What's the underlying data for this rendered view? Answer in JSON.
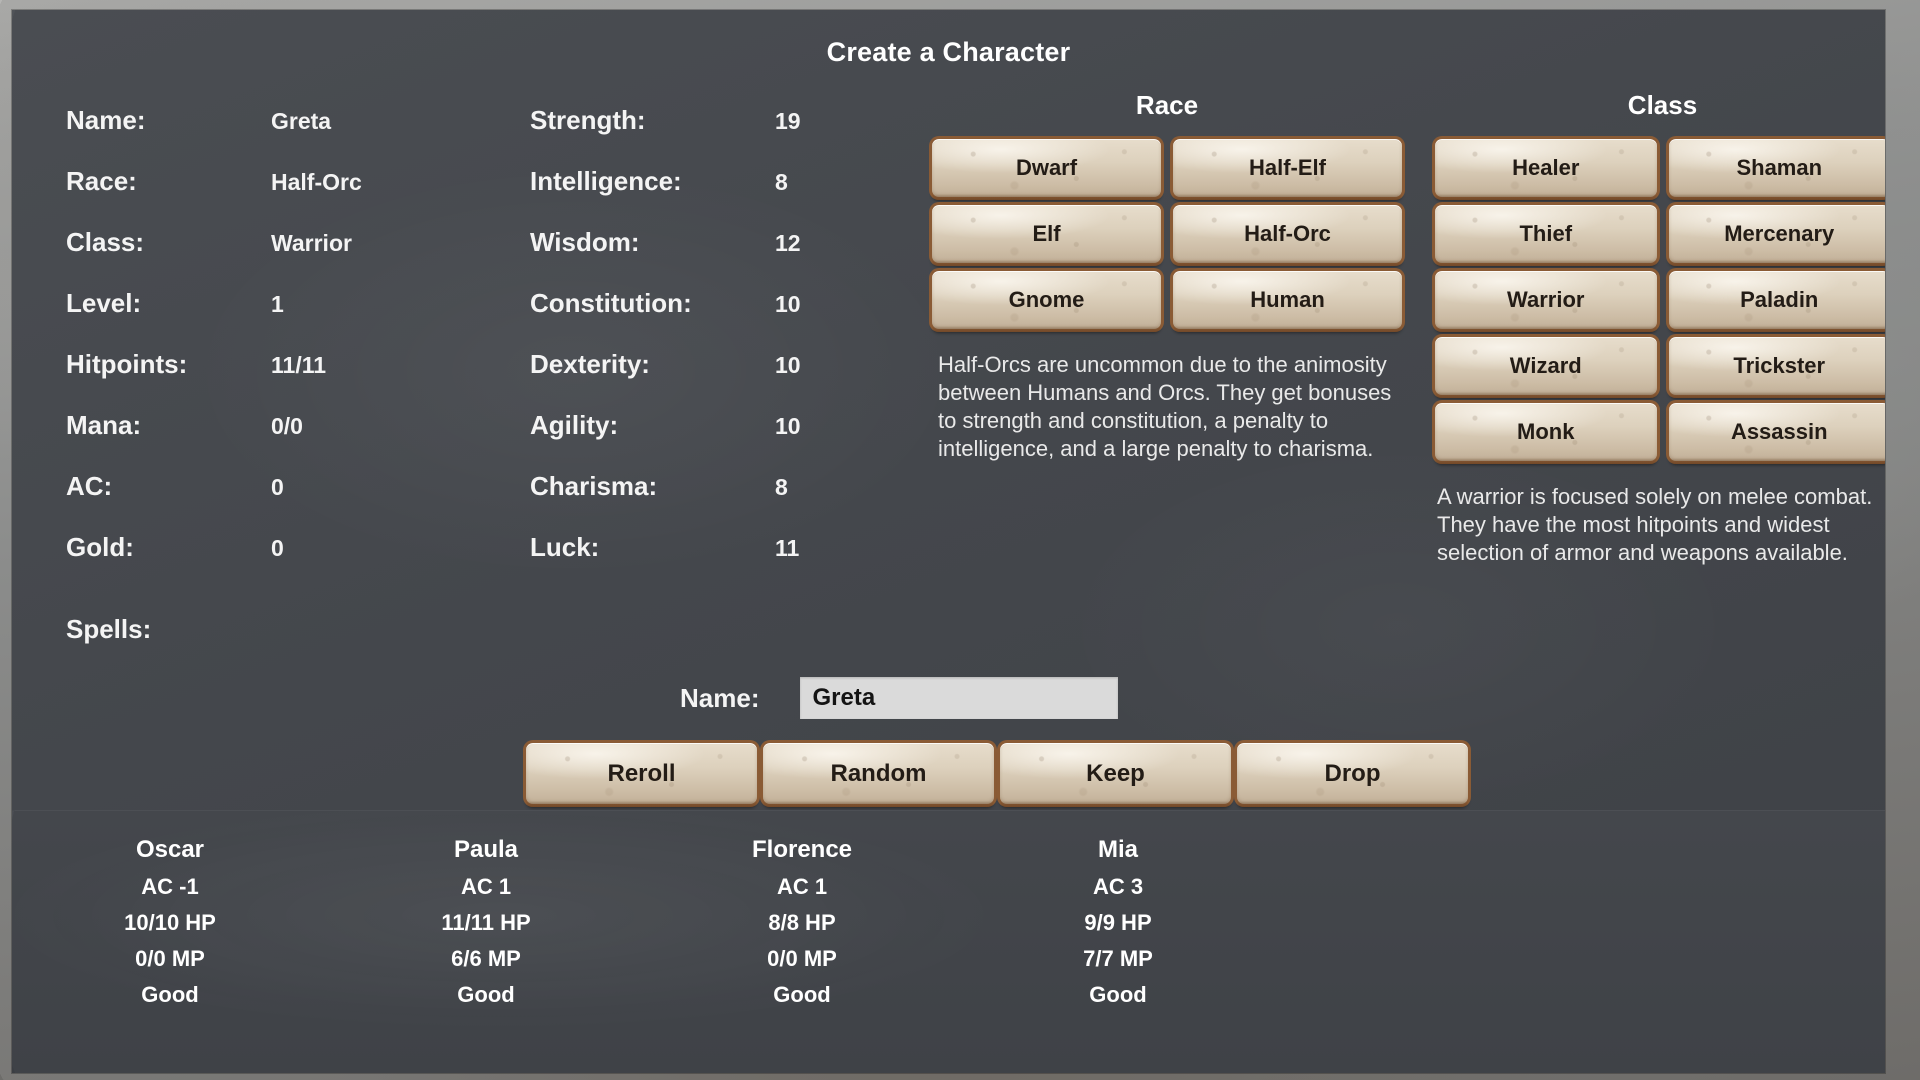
{
  "title": "Create a Character",
  "sheet": {
    "rows": [
      {
        "label": "Name:",
        "value": "Greta"
      },
      {
        "label": "Race:",
        "value": "Half-Orc"
      },
      {
        "label": "Class:",
        "value": "Warrior"
      },
      {
        "label": "Level:",
        "value": "1"
      },
      {
        "label": "Hitpoints:",
        "value": "11/11"
      },
      {
        "label": "Mana:",
        "value": "0/0"
      },
      {
        "label": "AC:",
        "value": "0"
      },
      {
        "label": "Gold:",
        "value": "0"
      }
    ],
    "spells_label": "Spells:",
    "spells_value": ""
  },
  "attributes": {
    "rows": [
      {
        "label": "Strength:",
        "value": "19"
      },
      {
        "label": "Intelligence:",
        "value": "8"
      },
      {
        "label": "Wisdom:",
        "value": "12"
      },
      {
        "label": "Constitution:",
        "value": "10"
      },
      {
        "label": "Dexterity:",
        "value": "10"
      },
      {
        "label": "Agility:",
        "value": "10"
      },
      {
        "label": "Charisma:",
        "value": "8"
      },
      {
        "label": "Luck:",
        "value": "11"
      }
    ]
  },
  "race": {
    "title": "Race",
    "options": [
      "Dwarf",
      "Half-Elf",
      "Elf",
      "Half-Orc",
      "Gnome",
      "Human"
    ],
    "selected": "Half-Orc",
    "description": "Half-Orcs are uncommon due to the animosity between Humans and Orcs. They get bonuses to strength and constitution, a penalty to intelligence, and a large penalty to charisma."
  },
  "klass": {
    "title": "Class",
    "options": [
      "Healer",
      "Shaman",
      "Thief",
      "Mercenary",
      "Warrior",
      "Paladin",
      "Wizard",
      "Trickster",
      "Monk",
      "Assassin"
    ],
    "selected": "Warrior",
    "description": "A warrior is focused solely on melee combat. They have the most hitpoints and widest selection of armor and weapons available."
  },
  "name_entry": {
    "label": "Name:",
    "value": "Greta",
    "placeholder": ""
  },
  "actions": [
    "Reroll",
    "Random",
    "Keep",
    "Drop"
  ],
  "party": [
    {
      "name": "Oscar",
      "ac": "AC -1",
      "hp": "10/10 HP",
      "mp": "0/0 MP",
      "alignment": "Good"
    },
    {
      "name": "Paula",
      "ac": "AC 1",
      "hp": "11/11 HP",
      "mp": "6/6 MP",
      "alignment": "Good"
    },
    {
      "name": "Florence",
      "ac": "AC 1",
      "hp": "8/8 HP",
      "mp": "0/0 MP",
      "alignment": "Good"
    },
    {
      "name": "Mia",
      "ac": "AC 3",
      "hp": "9/9 HP",
      "mp": "7/7 MP",
      "alignment": "Good"
    }
  ],
  "colors": {
    "panel": "#44474c",
    "button_face": "#ddd0bd",
    "button_border": "#8a5b35",
    "text": "#f4f4f4",
    "input_bg": "#dadada"
  }
}
